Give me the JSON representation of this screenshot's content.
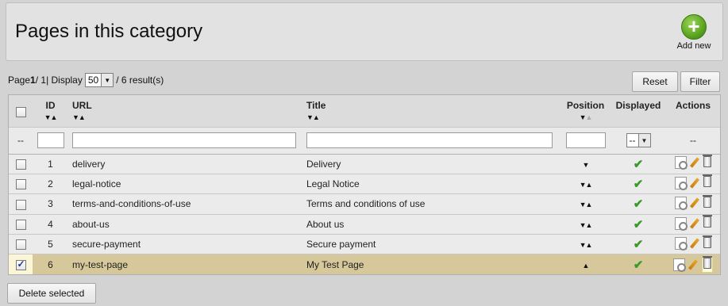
{
  "header": {
    "title": "Pages in this category",
    "add_new_label": "Add new"
  },
  "pagination": {
    "page_label": "Page",
    "page_current": "1",
    "page_sep": " / 1",
    "display_label": " | Display",
    "per_page": "50",
    "results_text": "/ 6 result(s)"
  },
  "buttons": {
    "reset": "Reset",
    "filter": "Filter",
    "delete_selected": "Delete selected"
  },
  "table": {
    "columns": {
      "id": "ID",
      "url": "URL",
      "title": "Title",
      "position": "Position",
      "displayed": "Displayed",
      "actions": "Actions"
    },
    "filter_dash": "--",
    "displayed_filter_value": "--",
    "actions_filter": "--",
    "rows": [
      {
        "id": "1",
        "url": "delivery",
        "title": "Delivery",
        "pos_arrows": "▼",
        "checked": false
      },
      {
        "id": "2",
        "url": "legal-notice",
        "title": "Legal Notice",
        "pos_arrows": "▼▲",
        "checked": false
      },
      {
        "id": "3",
        "url": "terms-and-conditions-of-use",
        "title": "Terms and conditions of use",
        "pos_arrows": "▼▲",
        "checked": false
      },
      {
        "id": "4",
        "url": "about-us",
        "title": "About us",
        "pos_arrows": "▼▲",
        "checked": false
      },
      {
        "id": "5",
        "url": "secure-payment",
        "title": "Secure payment",
        "pos_arrows": "▼▲",
        "checked": false
      },
      {
        "id": "6",
        "url": "my-test-page",
        "title": "My Test Page",
        "pos_arrows": "▲",
        "checked": true
      }
    ]
  },
  "colors": {
    "selected_row": "#d6c89a",
    "check_green": "#3a9a28",
    "add_green": "#5aa420"
  },
  "icons": [
    "add-icon",
    "view-icon",
    "edit-icon",
    "delete-icon",
    "check-icon",
    "sort-arrow-icon"
  ]
}
